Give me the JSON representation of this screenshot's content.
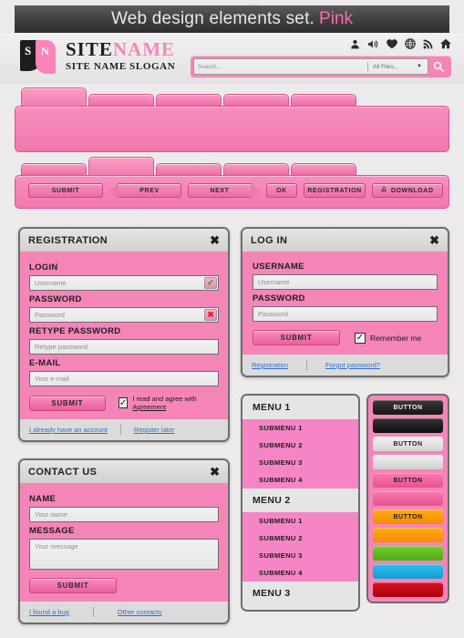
{
  "title_bar": {
    "text_main": "Web design elements set.",
    "text_accent": "Pink",
    "accent_color": "#f56fae"
  },
  "header": {
    "logo": {
      "mark_letter_1": "S",
      "mark_letter_2": "N",
      "name_part_1": "SITE",
      "name_part_2": "NAME",
      "slogan": "SITE NAME SLOGAN"
    },
    "icons": [
      "user-icon",
      "speaker-icon",
      "heart-icon",
      "globe-icon",
      "rss-icon",
      "home-icon"
    ],
    "search": {
      "placeholder": "Search...",
      "filter_value": "All Files..",
      "caret": "▼",
      "button_icon": "search-icon"
    }
  },
  "tab_panel_1": {
    "tabs": [
      "",
      "",
      "",
      "",
      ""
    ],
    "active_index": 0
  },
  "tab_panel_2": {
    "tabs": [
      "",
      "",
      "",
      "",
      ""
    ],
    "active_index": 1,
    "buttons": [
      {
        "label": "SUBMIT",
        "shape": "rect"
      },
      {
        "label": "PREV",
        "shape": "arrow-left"
      },
      {
        "label": "NEXT",
        "shape": "arrow-right"
      },
      {
        "label": "OK",
        "shape": "rect"
      },
      {
        "label": "REGISTRATION",
        "shape": "rect"
      },
      {
        "label": "DOWNLOAD",
        "shape": "rect",
        "icon": "download-icon",
        "icon_glyph": "⥥"
      }
    ]
  },
  "registration": {
    "title": "REGISTRATION",
    "close": "✖",
    "fields": [
      {
        "label": "LOGIN",
        "placeholder": "Username",
        "validation": "ok",
        "validation_glyph": "✔"
      },
      {
        "label": "PASSWORD",
        "placeholder": "Password",
        "validation": "error",
        "validation_glyph": "✖"
      },
      {
        "label": "RETYPE PASSWORD",
        "placeholder": "Retype password",
        "validation": "none"
      },
      {
        "label": "E-MAIL",
        "placeholder": "Your e-mail",
        "validation": "none"
      }
    ],
    "submit_label": "SUBMIT",
    "checkbox": {
      "checked": true,
      "glyph": "✓",
      "text_before": "I read and agree with ",
      "link": "Agreement"
    },
    "footer_links": [
      "I already have an account",
      "Register later"
    ]
  },
  "login": {
    "title": "LOG IN",
    "close": "✖",
    "fields": [
      {
        "label": "USERNAME",
        "placeholder": "Username"
      },
      {
        "label": "PASSWORD",
        "placeholder": "Password"
      }
    ],
    "submit_label": "SUBMIT",
    "checkbox": {
      "checked": true,
      "glyph": "✓",
      "text": "Remember me"
    },
    "footer_links": [
      "Registration",
      "Forgot password?"
    ]
  },
  "contact": {
    "title": "CONTACT US",
    "close": "✖",
    "fields": [
      {
        "label": "NAME",
        "placeholder": "Your name"
      },
      {
        "label": "MESSAGE",
        "placeholder": "Your message"
      }
    ],
    "submit_label": "SUBMIT",
    "footer_links": [
      "I found a bug",
      "Other contacts"
    ]
  },
  "menu": {
    "groups": [
      {
        "header": "MENU 1",
        "items": [
          "SUBMENU 1",
          "SUBMENU 2",
          "SUBMENU 3",
          "SUBMENU 4"
        ]
      },
      {
        "header": "MENU 2",
        "items": [
          "SUBMENU 1",
          "SUBMENU 2",
          "SUBMENU 3",
          "SUBMENU 4"
        ]
      },
      {
        "header": "MENU 3",
        "items": []
      }
    ]
  },
  "button_palette": {
    "buttons": [
      {
        "label": "BUTTON",
        "color": "#262626",
        "text_color": "#f2f2f2"
      },
      {
        "label": "",
        "color": "#1f1f1f",
        "text_color": "#f2f2f2"
      },
      {
        "label": "BUTTON",
        "color": "#e2e2e2",
        "text_color": "#1f1f1f"
      },
      {
        "label": "",
        "color": "#dedede",
        "text_color": "#1f1f1f"
      },
      {
        "label": "BUTTON",
        "color": "#f0679f",
        "text_color": "#1f1f1f"
      },
      {
        "label": "",
        "color": "#f0679f",
        "text_color": "#1f1f1f"
      },
      {
        "label": "BUTTON",
        "color": "#fb9600",
        "text_color": "#1f1f1f"
      },
      {
        "label": "",
        "color": "#fb9600",
        "text_color": "#1f1f1f"
      },
      {
        "label": "",
        "color": "#5fbe20",
        "text_color": "#1f1f1f"
      },
      {
        "label": "",
        "color": "#1cade4",
        "text_color": "#1f1f1f"
      },
      {
        "label": "",
        "color": "#c60012",
        "text_color": "#f2f2f2"
      }
    ]
  }
}
